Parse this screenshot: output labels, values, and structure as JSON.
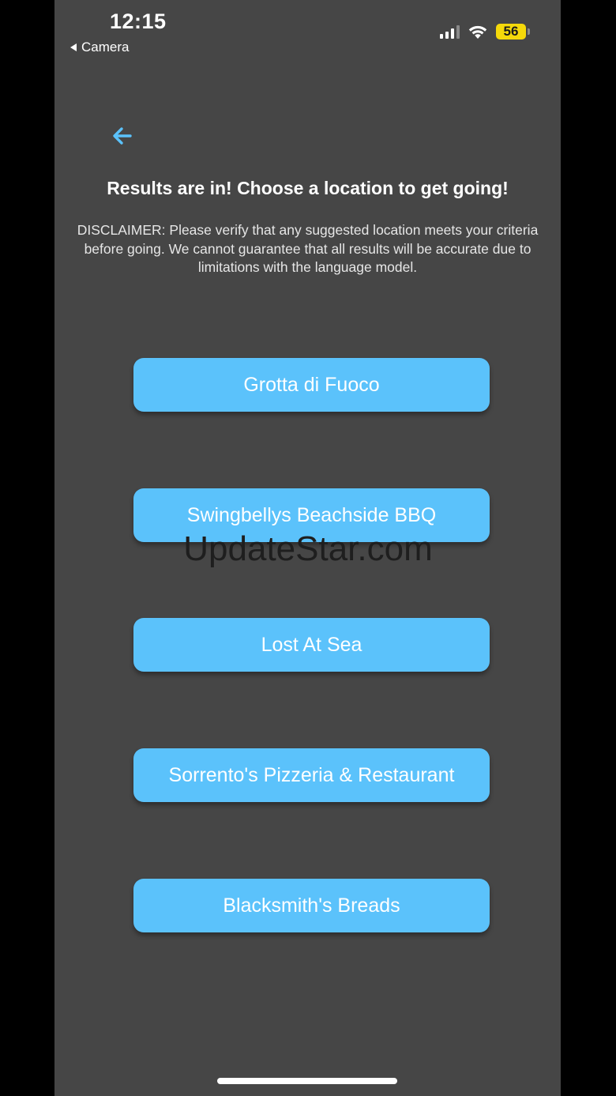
{
  "status_bar": {
    "time": "12:15",
    "back_app_label": "Camera",
    "battery_level": "56"
  },
  "header": {
    "title": "Results are in! Choose a location to get going!",
    "disclaimer": "DISCLAIMER: Please verify that any suggested location meets your criteria before going. We cannot guarantee that all results will be accurate due to limitations with the language model."
  },
  "locations": [
    {
      "label": "Grotta di Fuoco"
    },
    {
      "label": "Swingbellys Beachside BBQ"
    },
    {
      "label": "Lost At Sea"
    },
    {
      "label": "Sorrento's Pizzeria & Restaurant"
    },
    {
      "label": "Blacksmith's Breads"
    }
  ],
  "watermark": "UpdateStar.com",
  "colors": {
    "background": "#464646",
    "accent": "#5bc2fb",
    "back_arrow": "#5bc2fb",
    "battery": "#f5d90a"
  },
  "icons": {
    "back": "arrow-left-icon",
    "signal": "cellular-signal-icon",
    "wifi": "wifi-icon",
    "battery": "battery-icon"
  }
}
